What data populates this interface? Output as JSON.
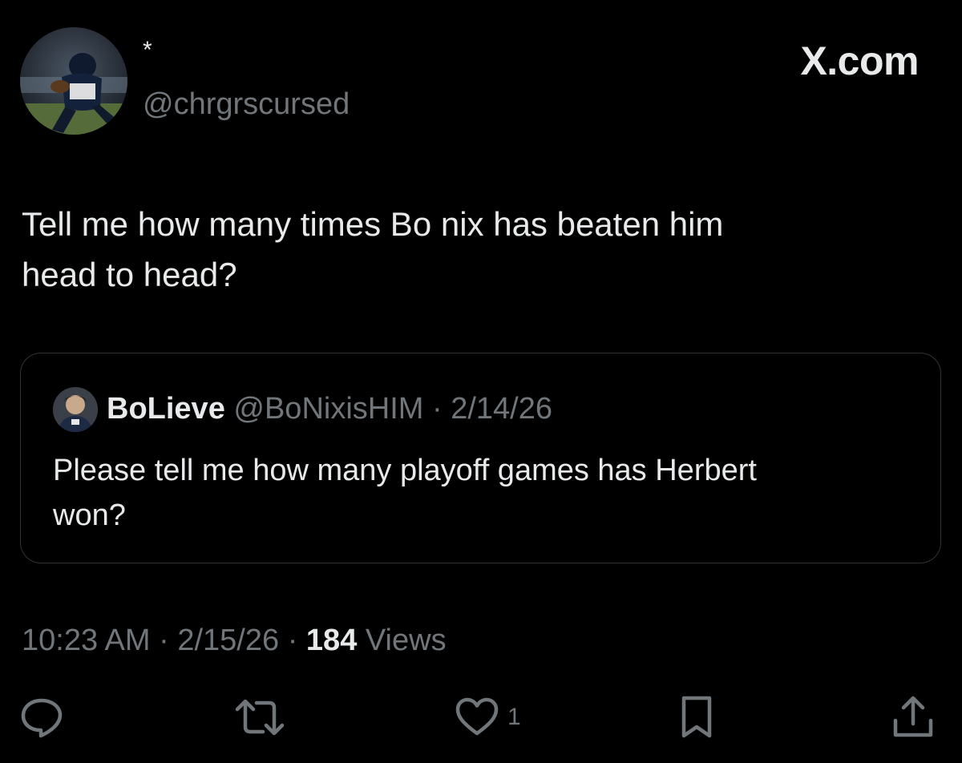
{
  "author": {
    "display_name": "*",
    "handle": "@chrgrscursed"
  },
  "brand": "X.com",
  "tweet": {
    "text_line1": "Tell me how many times Bo nix has beaten him",
    "text_line2": "head to head?"
  },
  "quoted_tweet": {
    "display_name": "BoLieve",
    "handle": "@BoNixisHIM",
    "separator": "·",
    "date": "2/14/26",
    "text_line1": "Please tell me how many playoff games has Herbert",
    "text_line2": "won?"
  },
  "meta": {
    "time": "10:23 AM",
    "date": "2/15/26",
    "separator": "·",
    "views_count": "184",
    "views_label": "Views"
  },
  "actions": {
    "like_count": "1",
    "icons": [
      "reply-icon",
      "retweet-icon",
      "like-icon",
      "bookmark-icon",
      "share-icon"
    ]
  },
  "colors": {
    "background": "#000000",
    "text": "#e7e9ea",
    "secondary": "#71767b",
    "border": "#2f3336"
  }
}
